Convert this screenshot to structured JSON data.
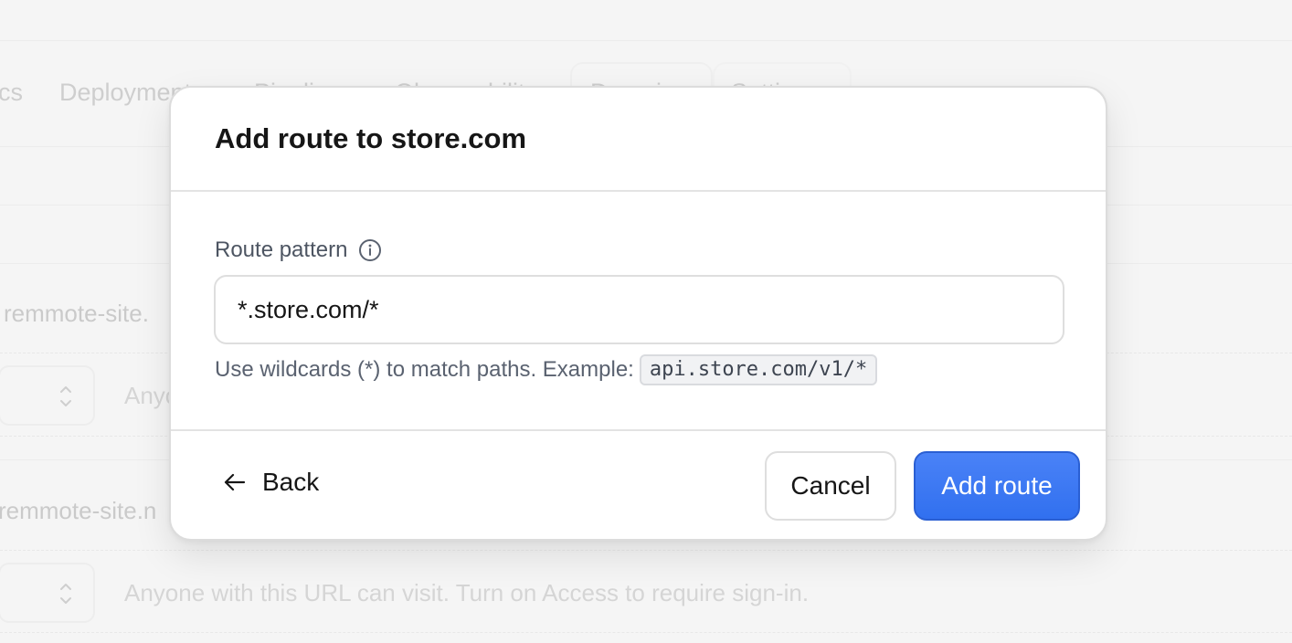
{
  "background": {
    "tabs": [
      "cs",
      "Deployments",
      "Pipelines",
      "Observability",
      "Domains",
      "Settings"
    ],
    "rows": [
      {
        "domain": "remmote-site.",
        "select_hint": "Anyo"
      },
      {
        "domain": "remmote-site.n",
        "select_hint": "Anyone with this URL can visit. Turn on Access to require sign-in."
      }
    ]
  },
  "modal": {
    "title": "Add route to store.com",
    "field": {
      "label": "Route pattern",
      "value": "*.store.com/*",
      "hint": "Use wildcards (*) to match paths. Example:",
      "example": "api.store.com/v1/*"
    },
    "footer": {
      "back_label": "Back",
      "cancel_label": "Cancel",
      "add_label": "Add route"
    }
  },
  "colors": {
    "primary": "#3a76f2",
    "primary_border": "#2a5fd3",
    "text": "#161616",
    "muted": "#5a6270"
  },
  "icons": [
    "info-icon",
    "arrow-left-icon",
    "chevron-updown-icon"
  ]
}
